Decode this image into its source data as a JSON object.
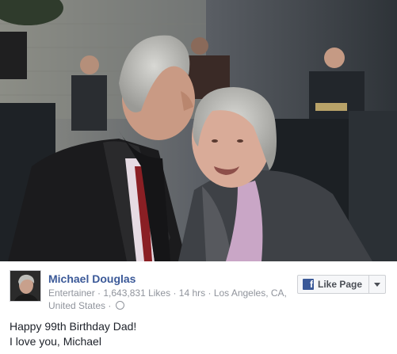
{
  "post": {
    "author": "Michael Douglas",
    "category": "Entertainer",
    "likes": "1,643,831 Likes",
    "time": "14 hrs",
    "location": "Los Angeles, CA, United States",
    "separator": " · ",
    "like_button_label": "Like Page",
    "like_button_icon": "facebook-f-icon",
    "message_lines": [
      "Happy 99th Birthday Dad!",
      "I love you, Michael"
    ]
  },
  "colors": {
    "author_link": "#3b5998",
    "meta_text": "#90949c",
    "body_text": "#1d2129",
    "button_bg": "#f6f7f9"
  }
}
